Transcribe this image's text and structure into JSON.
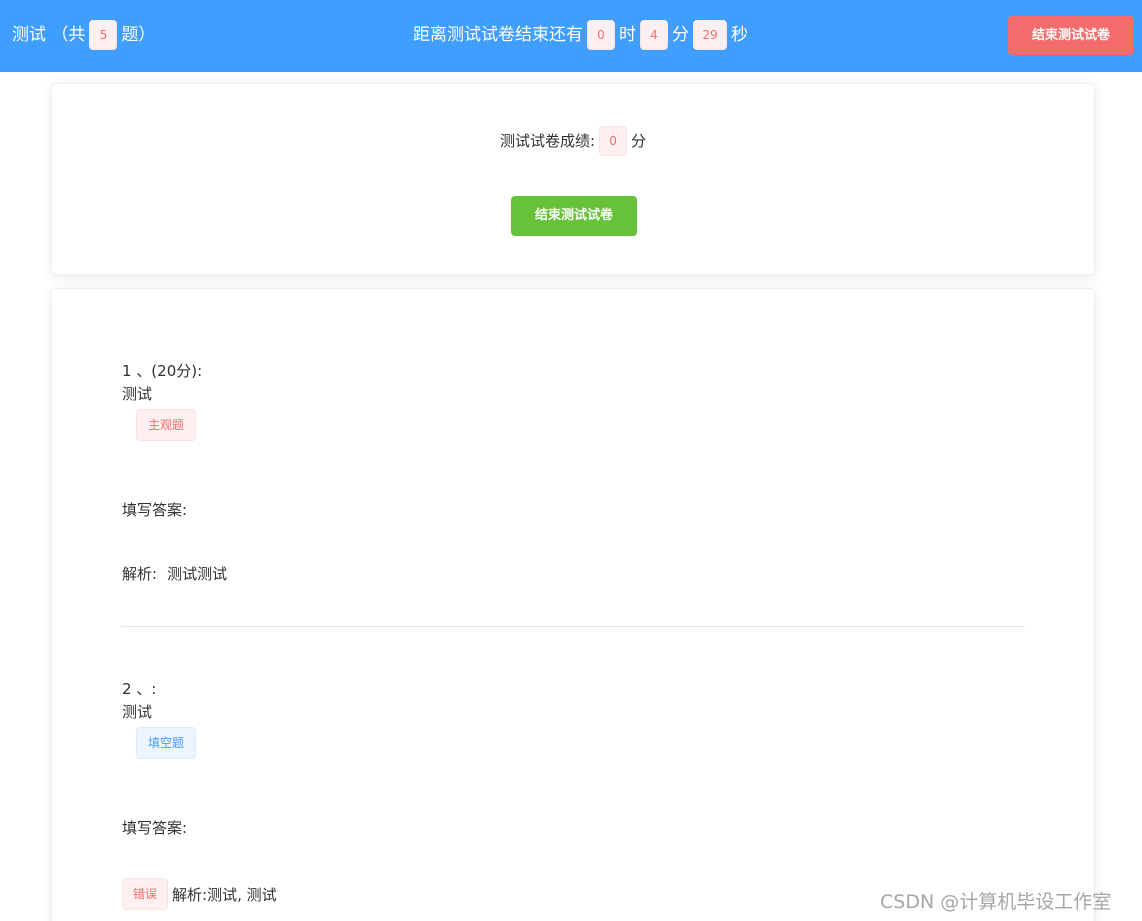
{
  "header": {
    "title_prefix": "测试 （共",
    "question_count": "5",
    "title_suffix": "题）",
    "timer_prefix": "距离测试试卷结束还有",
    "hours": "0",
    "hours_unit": "时",
    "minutes": "4",
    "minutes_unit": "分",
    "seconds": "29",
    "seconds_unit": "秒",
    "end_button": "结束测试试卷"
  },
  "score_card": {
    "label": "测试试卷成绩:",
    "score": "0",
    "unit": "分",
    "end_button": "结束测试试卷"
  },
  "questions": [
    {
      "header": "1 、(20分):",
      "text": "测试",
      "type": "主观题",
      "answer_label": "填写答案:",
      "analysis_label": "解析:",
      "analysis_text": "测试测试"
    },
    {
      "header": "2 、:",
      "text": "测试",
      "type": "填空题",
      "answer_label": "填写答案:",
      "result": "错误",
      "analysis_label": "解析:",
      "analysis_text": "测试, 测试"
    }
  ],
  "watermark": "CSDN @计算机毕设工作室",
  "colors": {
    "header_bg": "#409eff",
    "danger": "#f56c6c",
    "success": "#67c23a"
  }
}
